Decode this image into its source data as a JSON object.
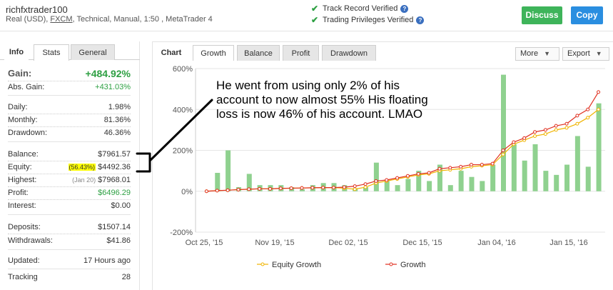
{
  "header": {
    "account_name": "richfxtrader100",
    "account_type": "Real (USD),",
    "broker": "FXCM",
    "account_details": ", Technical, Manual, 1:50 , MetaTrader 4",
    "verifications": [
      "Track Record Verified",
      "Trading Privileges Verified"
    ],
    "discuss_label": "Discuss",
    "copy_label": "Copy"
  },
  "left_tabs": [
    "Info",
    "Stats",
    "General"
  ],
  "stats": {
    "gain_label": "Gain:",
    "gain_value": "+484.92%",
    "abs_gain_label": "Abs. Gain:",
    "abs_gain_value": "+431.03%",
    "daily_label": "Daily:",
    "daily_value": "1.98%",
    "monthly_label": "Monthly:",
    "monthly_value": "81.36%",
    "drawdown_label": "Drawdown:",
    "drawdown_value": "46.36%",
    "balance_label": "Balance:",
    "balance_value": "$7961.57",
    "equity_label": "Equity:",
    "equity_pct": "(56.43%)",
    "equity_value": "$4492.36",
    "highest_label": "Highest:",
    "highest_date": "(Jan 20)",
    "highest_value": "$7968.01",
    "profit_label": "Profit:",
    "profit_value": "$6496.29",
    "interest_label": "Interest:",
    "interest_value": "$0.00",
    "deposits_label": "Deposits:",
    "deposits_value": "$1507.14",
    "withdrawals_label": "Withdrawals:",
    "withdrawals_value": "$41.86",
    "updated_label": "Updated:",
    "updated_value": "17 Hours ago",
    "tracking_label": "Tracking",
    "tracking_value": "28"
  },
  "chart_tabs": {
    "title": "Chart",
    "tabs": [
      "Growth",
      "Balance",
      "Profit",
      "Drawdown"
    ],
    "more_label": "More",
    "export_label": "Export"
  },
  "annotation": "He went from using only 2% of his account to now almost 55% His floating loss is now 46% of his account. LMAO",
  "colors": {
    "bar": "#8fd18f",
    "growth_line": "#e03020",
    "equity_line": "#f0b400",
    "accent_green": "#2ea043"
  },
  "chart_data": {
    "type": "bar+line",
    "x_ticks": [
      "Oct 25, '15",
      "Nov 19, '15",
      "Dec 02, '15",
      "Dec 15, '15",
      "Jan 04, '16",
      "Jan 15, '16"
    ],
    "y_ticks": [
      "600%",
      "400%",
      "200%",
      "0%",
      "-200%"
    ],
    "ylim": [
      -200,
      600
    ],
    "bars": [
      0,
      90,
      200,
      20,
      85,
      30,
      30,
      30,
      20,
      10,
      30,
      40,
      40,
      30,
      15,
      20,
      140,
      50,
      30,
      60,
      100,
      50,
      130,
      30,
      100,
      70,
      50,
      130,
      570,
      230,
      150,
      230,
      100,
      80,
      130,
      270,
      120,
      430
    ],
    "series": [
      {
        "name": "Equity Growth",
        "values": [
          0,
          3,
          5,
          8,
          10,
          12,
          12,
          14,
          15,
          16,
          17,
          18,
          18,
          15,
          10,
          20,
          40,
          50,
          60,
          70,
          80,
          85,
          100,
          105,
          110,
          120,
          125,
          130,
          180,
          230,
          250,
          270,
          280,
          300,
          310,
          330,
          360,
          400
        ]
      },
      {
        "name": "Growth",
        "values": [
          0,
          3,
          5,
          8,
          10,
          12,
          12,
          14,
          15,
          16,
          17,
          18,
          18,
          20,
          25,
          35,
          50,
          55,
          65,
          75,
          85,
          90,
          110,
          115,
          120,
          130,
          130,
          135,
          200,
          240,
          260,
          290,
          300,
          320,
          330,
          370,
          400,
          485
        ]
      }
    ],
    "legend": [
      "Equity Growth",
      "Growth"
    ],
    "legend_position": "bottom",
    "grid": true
  }
}
